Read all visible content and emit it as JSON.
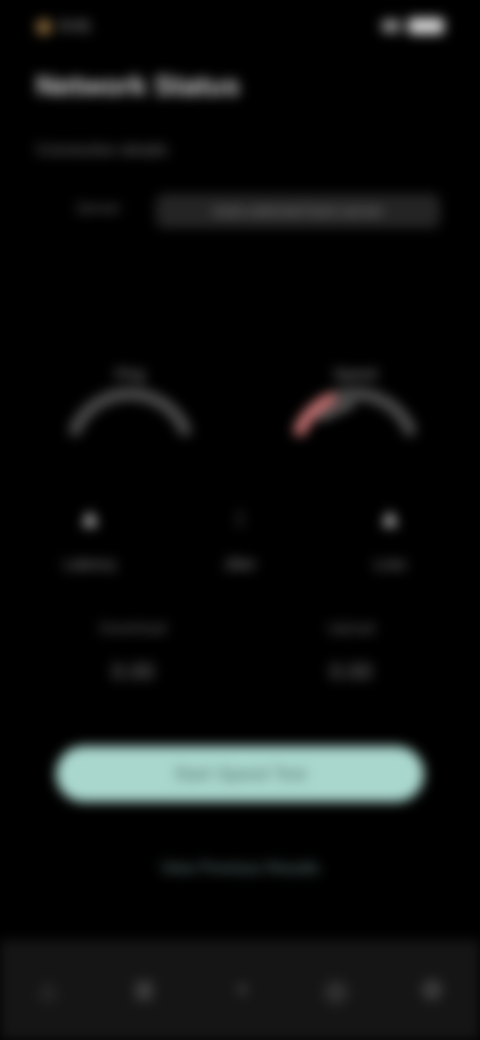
{
  "status_bar": {
    "time": "9:41",
    "signal_icon": "signal-icon",
    "battery_icon": "battery-icon"
  },
  "header": {
    "title": "Network Status",
    "subtitle": "Connection details"
  },
  "server": {
    "label": "Server",
    "value": "Auto-selected best server"
  },
  "gauges": [
    {
      "label": "Ping",
      "value": "",
      "level": 0.0,
      "color": "#5a5a5a"
    },
    {
      "label": "Speed",
      "value": "",
      "level": 0.32,
      "color": "#d37a7a"
    }
  ],
  "stats": [
    {
      "label": "Latency",
      "icon": "upload-arrow-icon",
      "glyph": "▲"
    },
    {
      "label": "Jitter",
      "icon": "jitter-icon",
      "glyph": "↕"
    },
    {
      "label": "Loss",
      "icon": "upload-arrow-icon",
      "glyph": "▲"
    }
  ],
  "rates": {
    "download_label": "Download",
    "download_value": "0.00",
    "upload_label": "Upload",
    "upload_value": "0.00"
  },
  "actions": {
    "primary_label": "Start Speed Test",
    "link_label": "View Previous Results"
  },
  "bottom_nav": [
    {
      "name": "home",
      "icon": "home-icon",
      "glyph": "⌂"
    },
    {
      "name": "history",
      "icon": "history-icon",
      "glyph": "≣"
    },
    {
      "name": "test",
      "icon": "speedometer-icon",
      "glyph": "◔"
    },
    {
      "name": "servers",
      "icon": "globe-icon",
      "glyph": "◎"
    },
    {
      "name": "settings",
      "icon": "gear-icon",
      "glyph": "⚙"
    }
  ]
}
